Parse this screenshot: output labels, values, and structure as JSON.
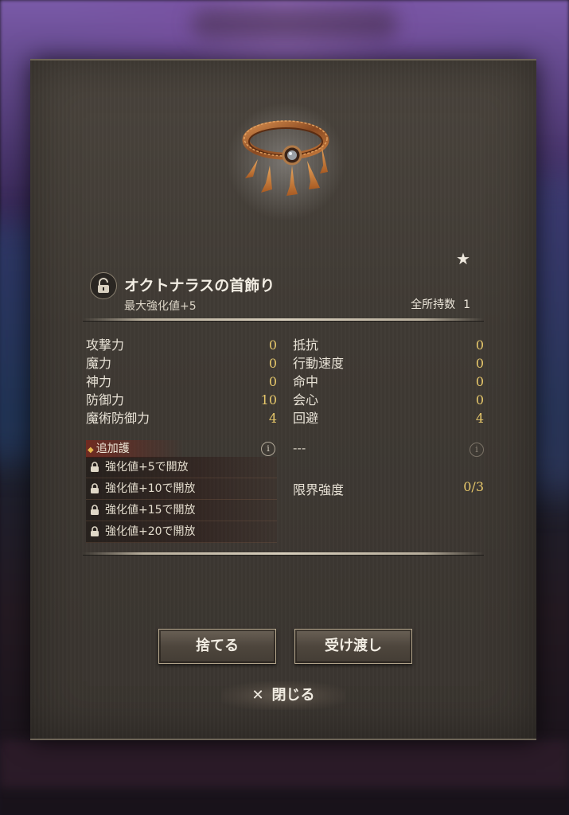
{
  "item": {
    "name": "オクトナラスの首飾り",
    "max_enhance": "最大強化値+5",
    "owned_label": "全所持数",
    "owned_count": "1",
    "favorite_icon": "star-icon",
    "lock_icon": "unlock-icon"
  },
  "stats_left": [
    {
      "label": "攻撃力",
      "value": "0"
    },
    {
      "label": "魔力",
      "value": "0"
    },
    {
      "label": "神力",
      "value": "0"
    },
    {
      "label": "防御力",
      "value": "10"
    },
    {
      "label": "魔術防御力",
      "value": "4"
    }
  ],
  "stats_right": [
    {
      "label": "抵抗",
      "value": "0"
    },
    {
      "label": "行動速度",
      "value": "0"
    },
    {
      "label": "命中",
      "value": "0"
    },
    {
      "label": "会心",
      "value": "0"
    },
    {
      "label": "回避",
      "value": "4"
    }
  ],
  "extra": {
    "title": "追加護",
    "unlocks": [
      "強化値+5で開放",
      "強化値+10で開放",
      "強化値+15で開放",
      "強化値+20で開放"
    ],
    "right_text": "---",
    "info_icon_glyph": "i"
  },
  "limit": {
    "label": "限界強度",
    "value": "0/3"
  },
  "buttons": {
    "discard": "捨てる",
    "transfer": "受け渡し",
    "close": "閉じる",
    "close_glyph": "✕"
  },
  "colors": {
    "accent_value": "#e6c76a",
    "panel": "#433e37"
  }
}
